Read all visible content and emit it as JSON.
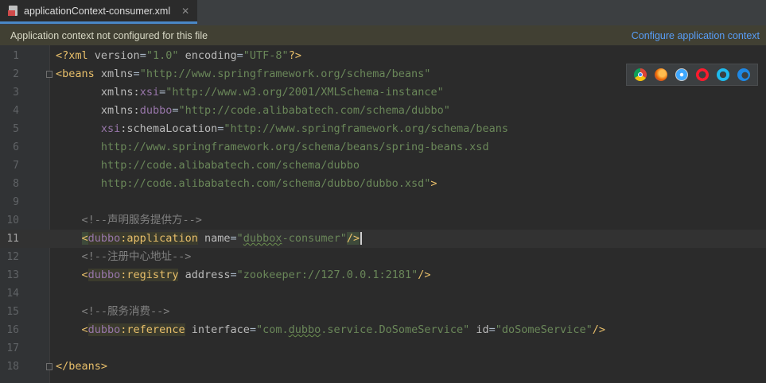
{
  "tab": {
    "label": "applicationContext-consumer.xml",
    "close": "✕"
  },
  "banner": {
    "message": "Application context not configured for this file",
    "link": "Configure application context"
  },
  "browsers": [
    "chrome-icon",
    "firefox-icon",
    "safari-icon",
    "opera-icon",
    "internet-explorer-icon",
    "edge-icon"
  ],
  "lines": [
    {
      "n": "1",
      "tokens": [
        [
          "b",
          "<?xml "
        ],
        [
          "a",
          "version"
        ],
        [
          "t",
          "="
        ],
        [
          "s",
          "\"1.0\""
        ],
        [
          "t",
          " "
        ],
        [
          "a",
          "encoding"
        ],
        [
          "t",
          "="
        ],
        [
          "s",
          "\"UTF-8\""
        ],
        [
          "b",
          "?>"
        ]
      ]
    },
    {
      "n": "2",
      "fold": true,
      "tokens": [
        [
          "b",
          "<beans "
        ],
        [
          "a",
          "xmlns"
        ],
        [
          "t",
          "="
        ],
        [
          "s",
          "\"http://www.springframework.org/schema/beans\""
        ]
      ]
    },
    {
      "n": "3",
      "tokens": [
        [
          "t",
          "       "
        ],
        [
          "a",
          "xmlns:"
        ],
        [
          "ns",
          "xsi"
        ],
        [
          "t",
          "="
        ],
        [
          "s",
          "\"http://www.w3.org/2001/XMLSchema-instance\""
        ]
      ]
    },
    {
      "n": "4",
      "tokens": [
        [
          "t",
          "       "
        ],
        [
          "a",
          "xmlns:"
        ],
        [
          "ns",
          "dubbo"
        ],
        [
          "t",
          "="
        ],
        [
          "s",
          "\"http://code.alibabatech.com/schema/dubbo\""
        ]
      ]
    },
    {
      "n": "5",
      "tokens": [
        [
          "t",
          "       "
        ],
        [
          "ns",
          "xsi"
        ],
        [
          "a",
          ":schemaLocation"
        ],
        [
          "t",
          "="
        ],
        [
          "s",
          "\"http://www.springframework.org/schema/beans"
        ]
      ]
    },
    {
      "n": "6",
      "tokens": [
        [
          "t",
          "       "
        ],
        [
          "s",
          "http://www.springframework.org/schema/beans/spring-beans.xsd"
        ]
      ]
    },
    {
      "n": "7",
      "tokens": [
        [
          "t",
          "       "
        ],
        [
          "s",
          "http://code.alibabatech.com/schema/dubbo"
        ]
      ]
    },
    {
      "n": "8",
      "tokens": [
        [
          "t",
          "       "
        ],
        [
          "s",
          "http://code.alibabatech.com/schema/dubbo/dubbo.xsd\""
        ],
        [
          "b",
          ">"
        ]
      ]
    },
    {
      "n": "9",
      "tokens": []
    },
    {
      "n": "10",
      "tokens": [
        [
          "t",
          "    "
        ],
        [
          "c",
          "<!--声明服务提供方-->"
        ]
      ]
    },
    {
      "n": "11",
      "current": true,
      "tokens": [
        [
          "t",
          "    "
        ],
        [
          "bhlg",
          "<"
        ],
        [
          "nshl",
          "dubbo"
        ],
        [
          "bhl",
          ":application"
        ],
        [
          "t",
          " "
        ],
        [
          "a",
          "name"
        ],
        [
          "t",
          "="
        ],
        [
          "s",
          "\""
        ],
        [
          "sq",
          "dubbox"
        ],
        [
          "s",
          "-consumer\""
        ],
        [
          "bhlg",
          "/>"
        ],
        [
          "caret",
          ""
        ]
      ]
    },
    {
      "n": "12",
      "tokens": [
        [
          "t",
          "    "
        ],
        [
          "c",
          "<!--注册中心地址-->"
        ]
      ]
    },
    {
      "n": "13",
      "tokens": [
        [
          "t",
          "    "
        ],
        [
          "b",
          "<"
        ],
        [
          "nshl",
          "dubbo"
        ],
        [
          "bhl",
          ":registry"
        ],
        [
          "t",
          " "
        ],
        [
          "a",
          "address"
        ],
        [
          "t",
          "="
        ],
        [
          "s",
          "\"zookeeper://127.0.0.1:2181\""
        ],
        [
          "b",
          "/>"
        ]
      ]
    },
    {
      "n": "14",
      "tokens": []
    },
    {
      "n": "15",
      "tokens": [
        [
          "t",
          "    "
        ],
        [
          "c",
          "<!--服务消费-->"
        ]
      ]
    },
    {
      "n": "16",
      "tokens": [
        [
          "t",
          "    "
        ],
        [
          "b",
          "<"
        ],
        [
          "nshl",
          "dubbo"
        ],
        [
          "bhl",
          ":reference"
        ],
        [
          "t",
          " "
        ],
        [
          "a",
          "interface"
        ],
        [
          "t",
          "="
        ],
        [
          "s",
          "\"com."
        ],
        [
          "sq",
          "dubbo"
        ],
        [
          "s",
          ".service.DoSomeService\""
        ],
        [
          "t",
          " "
        ],
        [
          "a",
          "id"
        ],
        [
          "t",
          "="
        ],
        [
          "s",
          "\"doSomeService\""
        ],
        [
          "b",
          "/>"
        ]
      ]
    },
    {
      "n": "17",
      "tokens": []
    },
    {
      "n": "18",
      "fold": true,
      "tokens": [
        [
          "b",
          "</beans>"
        ]
      ]
    }
  ]
}
